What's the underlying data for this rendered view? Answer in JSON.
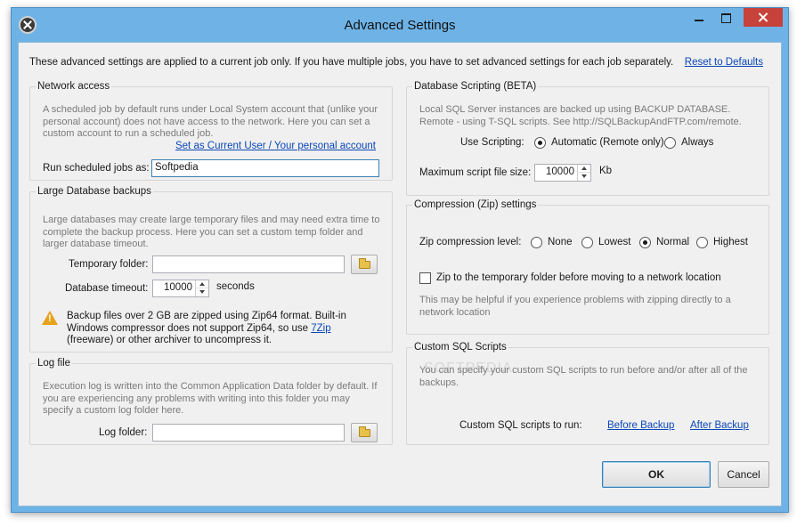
{
  "window": {
    "title": "Advanced Settings"
  },
  "intro": "These advanced settings are applied to a current job only. If you have multiple jobs, you have to set advanced settings for each job separately.",
  "reset_link": "Reset to Defaults",
  "network": {
    "legend": "Network access",
    "note": "A scheduled job by default runs under Local System account that (unlike your personal account) does not have access to the network. Here you can set a custom account to run a scheduled job.",
    "set_user_link": "Set as Current User / Your personal account",
    "run_label": "Run scheduled jobs as:",
    "run_value": "Softpedia"
  },
  "large_db": {
    "legend": "Large Database backups",
    "note": "Large databases may create large temporary files and may need extra time to complete the backup process. Here you can set a custom temp folder and larger database timeout.",
    "temp_label": "Temporary folder:",
    "temp_value": "",
    "timeout_label": "Database timeout:",
    "timeout_value": "10000",
    "timeout_unit": "seconds",
    "warning_before": "Backup files over 2 GB are zipped using Zip64 format. Built-in Windows compressor does not support Zip64, so use ",
    "warning_link": "7Zip",
    "warning_after": " (freeware) or other archiver to uncompress it."
  },
  "log": {
    "legend": "Log file",
    "note": "Execution log is written into the Common Application Data folder by default. If you are experiencing any problems with writing into this folder you may specify a custom log folder here.",
    "folder_label": "Log folder:",
    "folder_value": ""
  },
  "scripting": {
    "legend": "Database Scripting (BETA)",
    "note": "Local SQL Server instances are backed up using BACKUP DATABASE. Remote - using T-SQL scripts. See http://SQLBackupAndFTP.com/remote.",
    "use_label": "Use Scripting:",
    "option_automatic": "Automatic (Remote only)",
    "option_always": "Always",
    "max_label": "Maximum script file size:",
    "max_value": "10000",
    "max_unit": "Kb"
  },
  "compression": {
    "legend": "Compression (Zip) settings",
    "level_label": "Zip compression level:",
    "option_none": "None",
    "option_lowest": "Lowest",
    "option_normal": "Normal",
    "option_highest": "Highest",
    "temp_checkbox": "Zip to the temporary folder before moving to a network location",
    "note": "This may be helpful if you experience problems with zipping directly to a network location"
  },
  "custom_sql": {
    "legend": "Custom SQL Scripts",
    "note": "You can specify your custom SQL scripts to run before and/or after all of the backups.",
    "run_label": "Custom SQL scripts to run:",
    "before_link": "Before Backup",
    "after_link": "After Backup"
  },
  "buttons": {
    "ok": "OK",
    "cancel": "Cancel"
  },
  "watermark": "SOFTPEDIA"
}
